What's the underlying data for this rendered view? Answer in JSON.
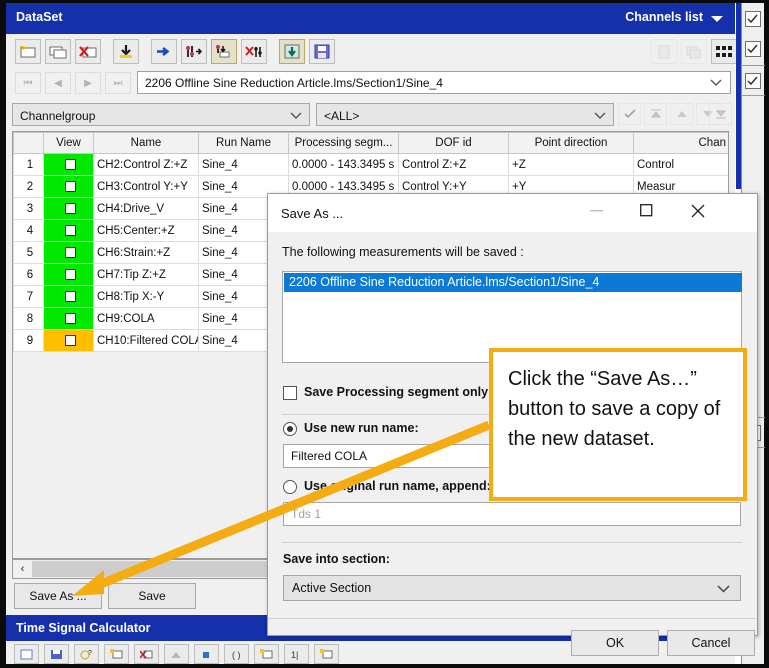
{
  "window": {
    "title": "DataSet",
    "channels_list_label": "Channels list",
    "caret_icon": "chevron-down-icon"
  },
  "toolbar": {
    "items": [
      {
        "name": "new-dataset-icon",
        "state": "enabled"
      },
      {
        "name": "copy-dataset-icon",
        "state": "enabled"
      },
      {
        "name": "delete-dataset-icon",
        "state": "enabled"
      },
      {
        "name": "import-down-icon",
        "state": "enabled"
      },
      {
        "name": "move-right-icon",
        "state": "enabled"
      },
      {
        "name": "add-channels-icon",
        "state": "enabled"
      },
      {
        "name": "replace-channels-icon",
        "state": "selected"
      },
      {
        "name": "remove-channels-icon",
        "state": "enabled"
      },
      {
        "name": "load-data-icon",
        "state": "enabled"
      },
      {
        "name": "save-data-icon",
        "state": "enabled"
      }
    ],
    "right_items": [
      {
        "name": "document-icon",
        "state": "disabled"
      },
      {
        "name": "copy-icon",
        "state": "disabled"
      },
      {
        "name": "grid-view-icon",
        "state": "enabled"
      }
    ]
  },
  "nav": {
    "first_icon": "first-record-icon",
    "prev_icon": "previous-record-icon",
    "next_icon": "next-record-icon",
    "last_icon": "last-record-icon",
    "path": "2206 Offline Sine Reduction Article.lms/Section1/Sine_4",
    "dropdown_icon": "chevron-down-icon"
  },
  "filters": {
    "group_by": "Channelgroup",
    "group_value": "<ALL>",
    "sort_icons": [
      "check-icon",
      "move-top-icon",
      "move-up-icon",
      "move-down-icon",
      "move-bottom-icon"
    ]
  },
  "table": {
    "columns": [
      "",
      "View",
      "Name",
      "Run Name",
      "Processing segm...",
      "DOF id",
      "Point direction",
      "Chan"
    ],
    "rows": [
      {
        "num": "1",
        "view_color": "green",
        "name": "CH2:Control Z:+Z",
        "run": "Sine_4",
        "seg": "0.0000 - 143.3495 s",
        "dof": "Control Z:+Z",
        "dir": "+Z",
        "chan": "Control"
      },
      {
        "num": "2",
        "view_color": "green",
        "name": "CH3:Control Y:+Y",
        "run": "Sine_4",
        "seg": "0.0000 - 143.3495 s",
        "dof": "Control Y:+Y",
        "dir": "+Y",
        "chan": "Measur"
      },
      {
        "num": "3",
        "view_color": "green",
        "name": "CH4:Drive_V",
        "run": "Sine_4",
        "seg": "",
        "dof": "",
        "dir": "",
        "chan": ""
      },
      {
        "num": "4",
        "view_color": "green",
        "name": "CH5:Center:+Z",
        "run": "Sine_4",
        "seg": "",
        "dof": "",
        "dir": "",
        "chan": ""
      },
      {
        "num": "5",
        "view_color": "green",
        "name": "CH6:Strain:+Z",
        "run": "Sine_4",
        "seg": "",
        "dof": "",
        "dir": "",
        "chan": ""
      },
      {
        "num": "6",
        "view_color": "green",
        "name": "CH7:Tip Z:+Z",
        "run": "Sine_4",
        "seg": "",
        "dof": "",
        "dir": "",
        "chan": ""
      },
      {
        "num": "7",
        "view_color": "green",
        "name": "CH8:Tip X:-Y",
        "run": "Sine_4",
        "seg": "",
        "dof": "",
        "dir": "",
        "chan": ""
      },
      {
        "num": "8",
        "view_color": "green",
        "name": "CH9:COLA",
        "run": "Sine_4",
        "seg": "",
        "dof": "",
        "dir": "",
        "chan": ""
      },
      {
        "num": "9",
        "view_color": "amber",
        "name": "CH10:Filtered COLA",
        "run": "Sine_4",
        "seg": "",
        "dof": "",
        "dir": "",
        "chan": ""
      }
    ]
  },
  "scrollbar": {
    "left_arrow": "‹"
  },
  "footer": {
    "save_as_label": "Save As ...",
    "save_label": "Save"
  },
  "time_signal_calculator": {
    "title": "Time Signal Calculator"
  },
  "dialog": {
    "title": "Save As ...",
    "minimize_icon": "minimize-icon",
    "maximize_icon": "maximize-icon",
    "close_icon": "close-icon",
    "measurements_label": "The following measurements will be saved :",
    "measurement_item": "2206 Offline Sine Reduction Article.lms/Section1/Sine_4",
    "save_segment_only_label": "Save Processing segment only",
    "save_segment_only_checked": false,
    "use_new_run_name_label": "Use new run name:",
    "use_new_run_name_selected": true,
    "new_run_name_value": "Filtered COLA",
    "use_original_run_name_label": "Use original run name, append:",
    "use_original_run_name_selected": false,
    "append_placeholder": "Tds 1",
    "save_into_section_label": "Save into section:",
    "save_into_section_value": "Active Section",
    "section_dropdown_icon": "chevron-down-icon",
    "ok_label": "OK",
    "cancel_label": "Cancel"
  },
  "callout": {
    "text": "Click the “Save As…” button to save a copy of the new dataset.",
    "border_color": "#f5ac12",
    "arrow_color": "#f5ac12"
  },
  "rail": {
    "checkbox_icon": "checked-checkbox-icon",
    "count": 4
  },
  "colors": {
    "title_blue": "#1430ab",
    "row_green": "#00e800",
    "row_amber": "#ffbf00",
    "selection_blue": "#0b7ad6",
    "accent_orange": "#f5ac12"
  }
}
